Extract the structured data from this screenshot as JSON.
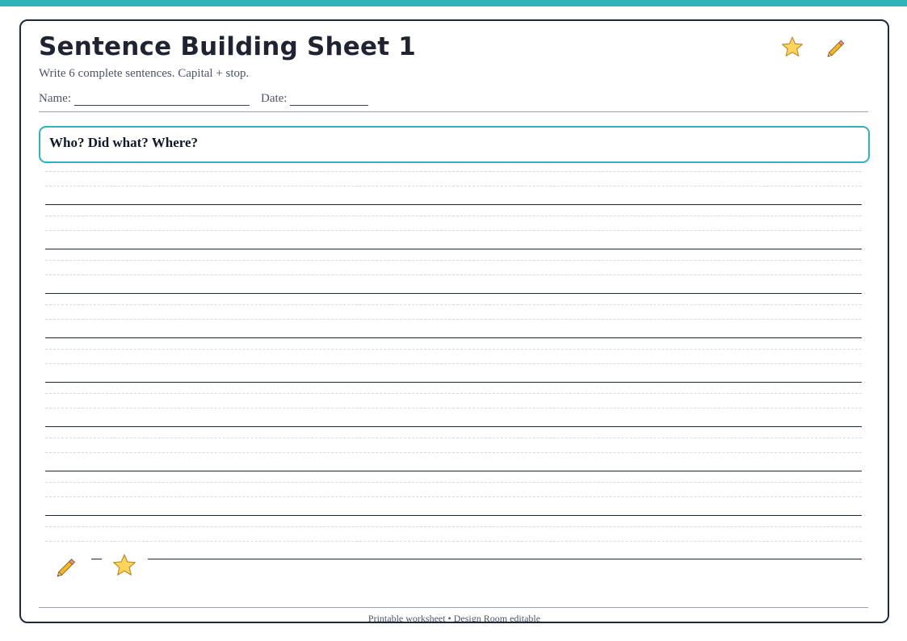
{
  "header": {
    "title": "Sentence Building Sheet 1",
    "subtitle": "Write 6 complete sentences. Capital + stop.",
    "name_label": "Name:",
    "date_label": "Date:"
  },
  "prompt": {
    "text": "Who? Did what? Where?"
  },
  "footer": {
    "text": "Printable worksheet • Design Room editable"
  },
  "colors": {
    "accent": "#2fb3b7",
    "ink": "#1f2937",
    "star_fill": "#ffd45c",
    "pencil_body": "#f5b72a"
  },
  "icons": {
    "header": [
      "star-icon",
      "pencil-icon"
    ],
    "footer": [
      "pencil-icon",
      "star-icon"
    ]
  }
}
